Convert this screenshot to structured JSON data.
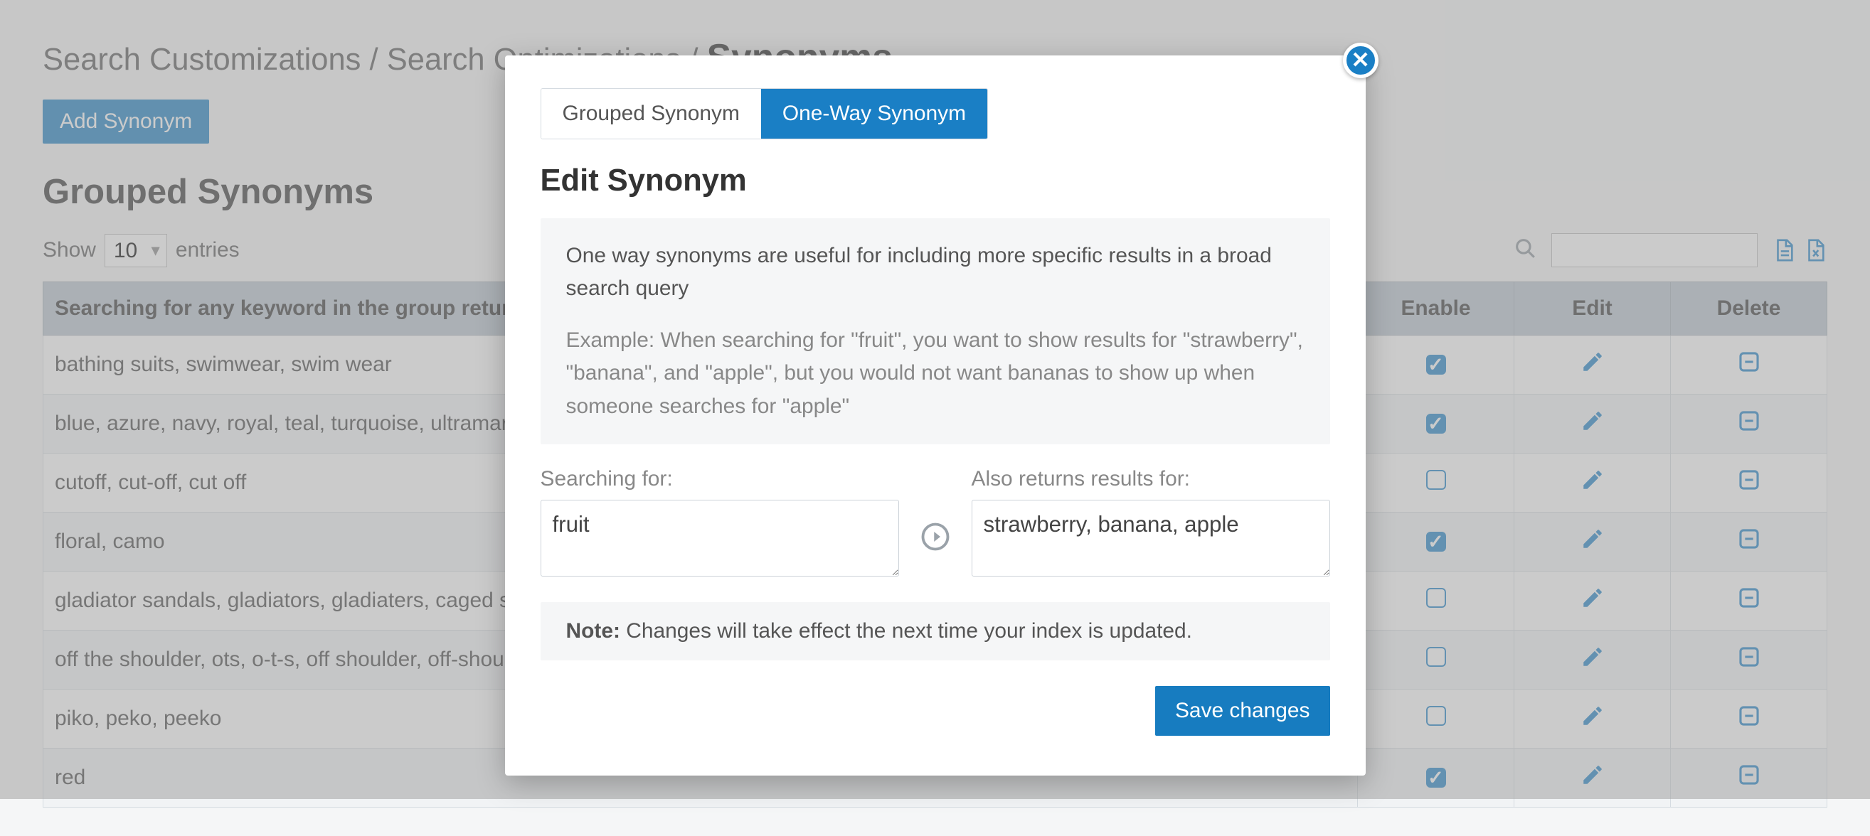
{
  "breadcrumb": {
    "a": "Search Customizations",
    "b": "Search Optimizations",
    "current": "Synonyms"
  },
  "buttons": {
    "add_synonym": "Add Synonym",
    "save_changes": "Save changes"
  },
  "section_title": "Grouped Synonyms",
  "table_controls": {
    "show_label": "Show",
    "entries_label": "entries",
    "page_size": "10"
  },
  "columns": {
    "keywords": "Searching for any keyword in the group returns results for all keywords in the group",
    "enable": "Enable",
    "edit": "Edit",
    "delete": "Delete"
  },
  "rows": [
    {
      "text": "bathing suits, swimwear, swim wear",
      "enabled": true
    },
    {
      "text": "blue, azure, navy, royal, teal, turquoise, ultramarine",
      "enabled": true
    },
    {
      "text": "cutoff, cut-off, cut off",
      "enabled": false
    },
    {
      "text": "floral, camo",
      "enabled": true
    },
    {
      "text": "gladiator sandals, gladiators, gladiaters, caged sandals",
      "enabled": false
    },
    {
      "text": "off the shoulder, ots, o-t-s, off shoulder, off-shoulder",
      "enabled": false
    },
    {
      "text": "piko, peko, peeko",
      "enabled": false
    },
    {
      "text": "red",
      "enabled": true
    }
  ],
  "modal": {
    "tabs": {
      "grouped": "Grouped Synonym",
      "oneway": "One-Way Synonym"
    },
    "title": "Edit Synonym",
    "info_main": "One way synonyms are useful for including more specific results in a broad search query",
    "info_example": "Example: When searching for \"fruit\", you want to show results for \"strawberry\", \"banana\", and \"apple\", but you would not want bananas to show up when someone searches for \"apple\"",
    "label_searching_for": "Searching for:",
    "label_also_returns": "Also returns results for:",
    "value_searching": "fruit",
    "value_returns": "strawberry, banana, apple",
    "note_prefix": "Note:",
    "note_text": " Changes will take effect the next time your index is updated."
  },
  "icons": {
    "search": "search-icon",
    "export_csv": "file-icon",
    "export_xls": "file-x-icon",
    "edit": "pencil-icon",
    "delete": "minus-square-icon",
    "close": "close-icon",
    "arrow": "arrow-right-circle-icon"
  }
}
